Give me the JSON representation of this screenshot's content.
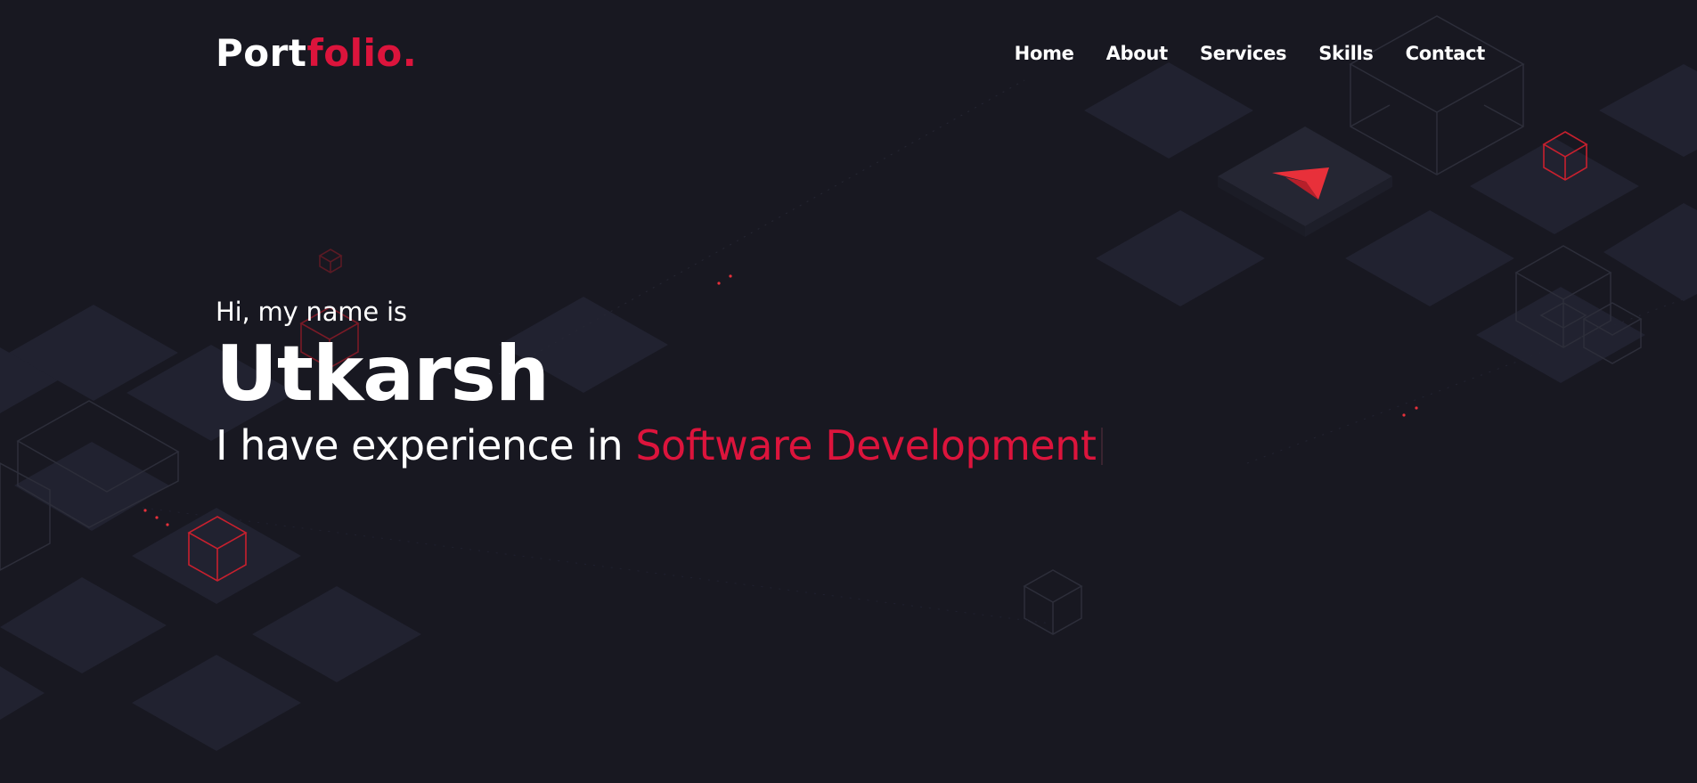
{
  "logo": {
    "main": "Port",
    "accent": "folio."
  },
  "nav": {
    "items": [
      {
        "label": "Home"
      },
      {
        "label": "About"
      },
      {
        "label": "Services"
      },
      {
        "label": "Skills"
      },
      {
        "label": "Contact"
      }
    ]
  },
  "hero": {
    "intro": "Hi, my name is",
    "name": "Utkarsh",
    "experience_prefix": "I have experience in",
    "experience_typed": "Software Development"
  },
  "colors": {
    "background": "#181821",
    "tile": "#222330",
    "accent": "#dc143c",
    "text": "#ffffff"
  },
  "icons": [
    "paper-plane-logo-icon",
    "cube-outline-icon"
  ]
}
